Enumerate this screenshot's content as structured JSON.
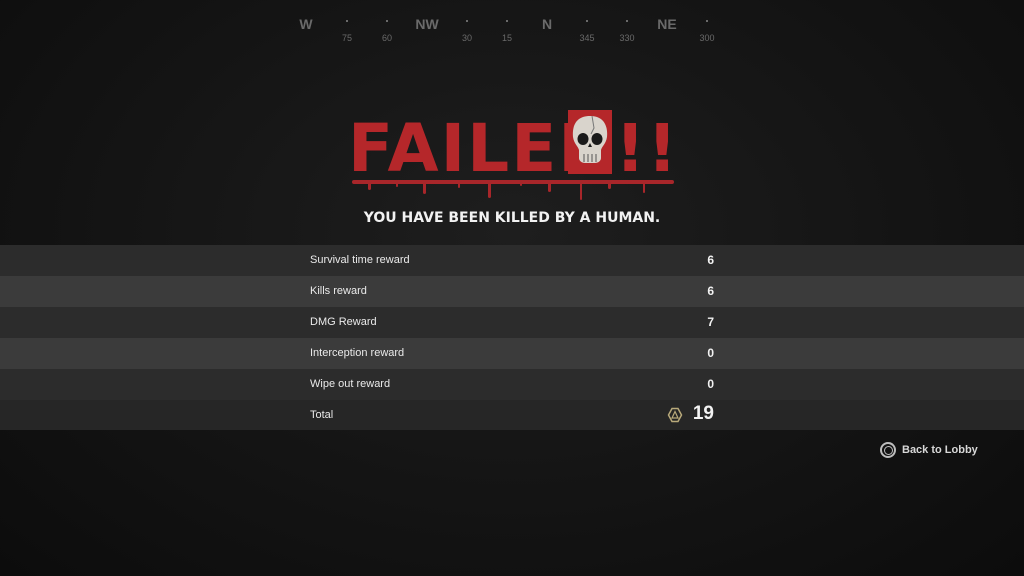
{
  "compass": {
    "cardinals": [
      {
        "label": "W"
      },
      {
        "label": "NW"
      },
      {
        "label": "N"
      },
      {
        "label": "NE"
      }
    ],
    "degrees": [
      "75",
      "60",
      "30",
      "15",
      "345",
      "330",
      "300"
    ]
  },
  "title": "FAILED!!",
  "subtitle": "YOU HAVE BEEN KILLED BY A HUMAN.",
  "rewards": [
    {
      "label": "Survival time reward",
      "value": "6"
    },
    {
      "label": "Kills reward",
      "value": "6"
    },
    {
      "label": "DMG Reward",
      "value": "7"
    },
    {
      "label": "Interception reward",
      "value": "0"
    },
    {
      "label": "Wipe out reward",
      "value": "0"
    }
  ],
  "total": {
    "label": "Total",
    "value": "19",
    "icon": "currency-icon"
  },
  "back_button": {
    "label": "Back to Lobby",
    "icon": "circle-button-icon"
  },
  "colors": {
    "accent": "#b5272a"
  }
}
